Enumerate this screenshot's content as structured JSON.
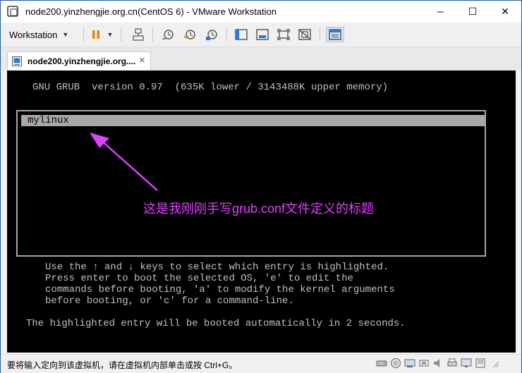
{
  "window": {
    "title": "node200.yinzhengjie.org.cn(CentOS 6) - VMware Workstation",
    "controls": {
      "minimize": "─",
      "maximize": "☐",
      "close": "✕"
    }
  },
  "toolbar": {
    "menu_label": "Workstation",
    "menu_caret": "▼",
    "pause_caret": "▼"
  },
  "tab": {
    "label": "node200.yinzhengjie.org....",
    "close": "×"
  },
  "console": {
    "header": "GNU GRUB  version 0.97  (635K lower / 3143488K upper memory)",
    "entries": [
      "mylinux"
    ],
    "annotation": "这是我刚刚手写grub.conf文件定义的标题",
    "help": [
      "Use the ↑ and ↓ keys to select which entry is highlighted.",
      "Press enter to boot the selected OS, 'e' to edit the",
      "commands before booting, 'a' to modify the kernel arguments",
      "before booting, or 'c' for a command-line."
    ],
    "countdown": "The highlighted entry will be booted automatically in 2 seconds."
  },
  "status": {
    "text": "要将输入定向到该虚拟机，请在虚拟机内部单击或按 Ctrl+G。"
  },
  "colors": {
    "annotation": "#e040ff",
    "console_bg": "#000000",
    "console_fg": "#c0c0c0",
    "highlight_bg": "#a8a8a8"
  }
}
